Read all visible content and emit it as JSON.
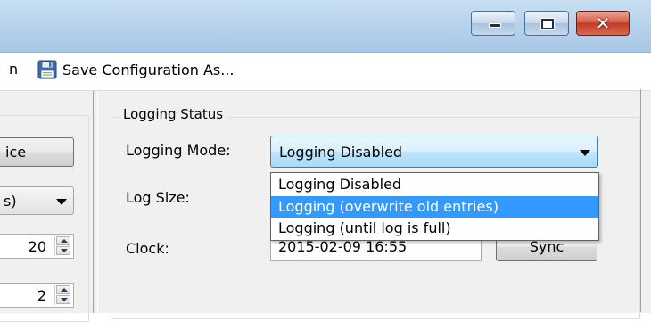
{
  "window": {
    "buttons": {
      "minimize_icon": "minimize-icon",
      "maximize_icon": "maximize-icon",
      "close_glyph": "✕"
    }
  },
  "menubar": {
    "partial_item": "n",
    "save_as_label": "Save Configuration As...",
    "save_icon": "floppy-disk-icon"
  },
  "left_panel": {
    "device_button_label": "ice",
    "combo_value": "s)",
    "spinner_1_value": "20",
    "spinner_2_value": "2"
  },
  "logging_status": {
    "group_title": "Logging Status",
    "mode_label": "Logging Mode:",
    "mode_selected": "Logging Disabled",
    "size_label": "Log Size:",
    "clock_label": "Clock:",
    "clock_value": "2015-02-09 16:55",
    "sync_label": "Sync",
    "dropdown_options": [
      "Logging Disabled",
      "Logging (overwrite old entries)",
      "Logging (until log is full)"
    ],
    "highlighted_option": "Logging (overwrite old entries)"
  },
  "colors": {
    "titlebar": "#b8d3ec",
    "close_button": "#c9452d",
    "selection_highlight": "#3399ff",
    "form_background": "#f0f0f0"
  }
}
